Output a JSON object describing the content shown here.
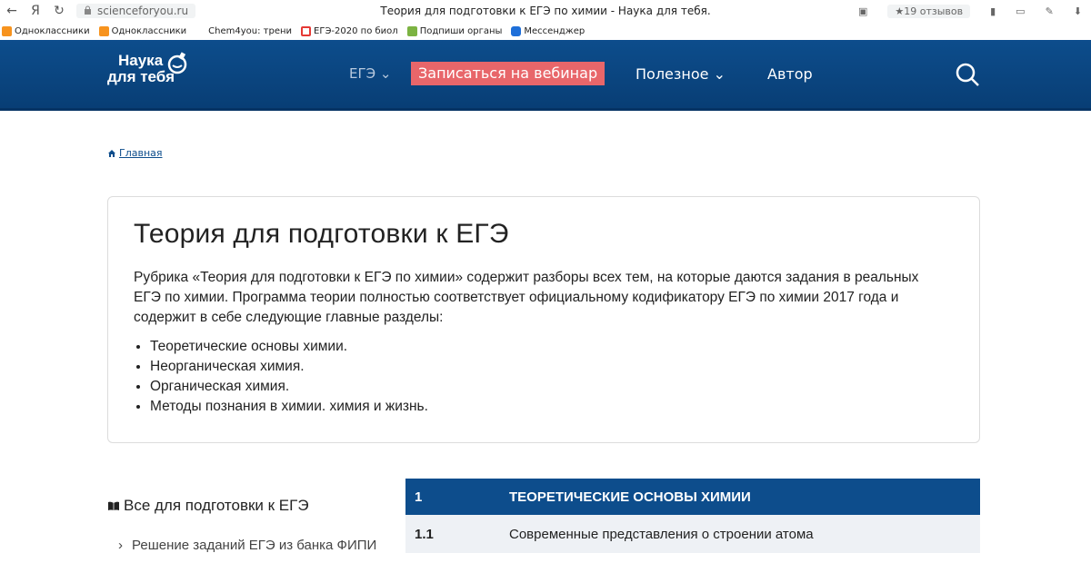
{
  "browser": {
    "url": "scienceforyou.ru",
    "tab_title": "Теория для подготовки к ЕГЭ по химии - Наука для тебя.",
    "reviews": "★19 отзывов"
  },
  "bookmarks": [
    {
      "label": "Одноклассники",
      "color": "#f7931e"
    },
    {
      "label": "Одноклассники",
      "color": "#f7931e"
    },
    {
      "label": "Chem4you: трени",
      "color": "#ffffff"
    },
    {
      "label": "ЕГЭ-2020 по биол",
      "color": "#e53935"
    },
    {
      "label": "Подпиши органы",
      "color": "#7cb342"
    },
    {
      "label": "Мессенджер",
      "color": "#1e6fd9"
    }
  ],
  "site": {
    "logo_line1": "Наука",
    "logo_line2": "для тебя",
    "menu": {
      "ege": "ЕГЭ ⌄",
      "webinar": "Записаться на вебинар",
      "useful": "Полезное ⌄",
      "author": "Автор"
    },
    "colors": {
      "header": "#0d4d8c",
      "webinar": "#e8666a"
    }
  },
  "breadcrumb": {
    "home": "Главная"
  },
  "main": {
    "title": "Теория для подготовки к ЕГЭ",
    "intro": "Рубрика «Теория для подготовки к ЕГЭ по химии» содержит разборы всех тем, на которые даются задания в реальных ЕГЭ по химии. Программа теории полностью соответствует официальному кодификатору ЕГЭ по химии 2017 года и  содержит в себе следующие главные разделы:",
    "sections": [
      "Теоретические основы химии.",
      "Неорганическая химия.",
      "Органическая химия.",
      "Методы познания в химии. химия и жизнь."
    ]
  },
  "sidebar": {
    "title": "Все для подготовки к ЕГЭ",
    "first_link": "Решение заданий ЕГЭ из банка ФИПИ"
  },
  "topics": [
    {
      "num": "1",
      "title": "ТЕОРЕТИЧЕСКИЕ ОСНОВЫ ХИМИИ"
    },
    {
      "num": "1.1",
      "title": "Современные представления о строении атома"
    }
  ]
}
